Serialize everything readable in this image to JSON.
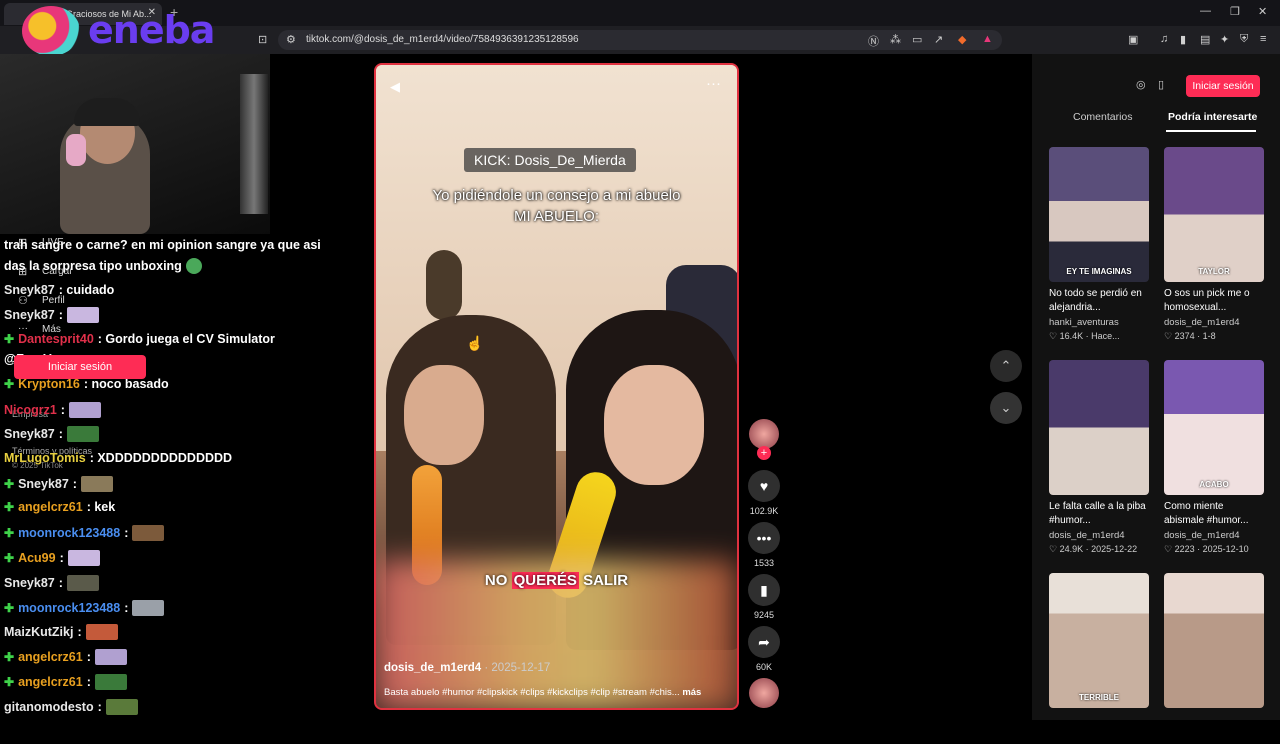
{
  "browser": {
    "tab_title": "Graciosos de Mi Ab...",
    "url": "tiktok.com/@dosis_de_m1erd4/video/7584936391235128596"
  },
  "overlay": {
    "brand": "eneba"
  },
  "tiktok_menu": {
    "live": "LIVE",
    "upload": "Cargar",
    "profile": "Perfil",
    "more": "Más",
    "login": "Iniciar sesión",
    "company": "Empresa",
    "terms": "Términos y políticas",
    "copyright": "© 2025 TikTok"
  },
  "chat": {
    "lines": [
      {
        "user": "",
        "text": "trah sangre o carne? en mi opinion sangre ya que asi",
        "color": "#ffffff"
      },
      {
        "user": "",
        "text": "das la sorpresa tipo unboxing",
        "color": "#ffffff"
      },
      {
        "user": "Sneyk87",
        "text": ": cuidado",
        "color": "#e8e8e8"
      },
      {
        "user": "Sneyk87",
        "text": ":",
        "color": "#e8e8e8"
      },
      {
        "user": "Dantesprit40",
        "text": ": Gordo juega el CV Simulator",
        "color": "#e0304a"
      },
      {
        "user": "@FgraV",
        "text": "",
        "color": "#ffffff"
      },
      {
        "user": "Krypton16",
        "text": ": noco basado",
        "color": "#e8a020"
      },
      {
        "user": "Nicogrz1",
        "text": ":",
        "color": "#e0304a"
      },
      {
        "user": "Sneyk87",
        "text": ":",
        "color": "#e8e8e8"
      },
      {
        "user": "MrLugoTomis",
        "text": ": XDDDDDDDDDDDDDD",
        "color": "#e8d040"
      },
      {
        "user": "Sneyk87",
        "text": ":",
        "color": "#e8e8e8"
      },
      {
        "user": "angelcrz61",
        "text": ": kek",
        "color": "#e8a020"
      },
      {
        "user": "moonrock123488",
        "text": ":",
        "color": "#4a8ef0"
      },
      {
        "user": "Acu99",
        "text": ":",
        "color": "#e8a020"
      },
      {
        "user": "Sneyk87",
        "text": ":",
        "color": "#e8e8e8"
      },
      {
        "user": "moonrock123488",
        "text": ":",
        "color": "#4a8ef0"
      },
      {
        "user": "MaizKutZikj",
        "text": ":",
        "color": "#e8e8e8"
      },
      {
        "user": "angelcrz61",
        "text": ":",
        "color": "#e8a020"
      },
      {
        "user": "angelcrz61",
        "text": ":",
        "color": "#e8a020"
      },
      {
        "user": "gitanomodesto",
        "text": ":",
        "color": "#e8e8e8"
      }
    ]
  },
  "video": {
    "kick_label": "KICK: Dosis_De_Mierda",
    "caption_top_1": "Yo pidiéndole un consejo a mi abuelo",
    "caption_top_2": "MI ABUELO:",
    "caption_bottom_pre": "NO ",
    "caption_bottom_hl": "QUERÉS",
    "caption_bottom_post": " SALIR",
    "author": "dosis_de_m1erd4",
    "date": "· 2025-12-17",
    "description": "Basta abuelo #humor #clipskick #clips #kickclips #clip #stream #chis...",
    "more": "más"
  },
  "actions": {
    "likes": "102.9K",
    "comments": "1533",
    "saves": "9245",
    "shares": "60K"
  },
  "right_panel": {
    "login": "Iniciar sesión",
    "tab_comments": "Comentarios",
    "tab_interest": "Podría interesarte",
    "cards": [
      {
        "title": "No todo se perdió en alejandria...",
        "channel": "hanki_aventuras",
        "stats": "♡ 16.4K · Hace...",
        "overlay": "EY TE IMAGINAS"
      },
      {
        "title": "O sos un pick me o homosexual...",
        "channel": "dosis_de_m1erd4",
        "stats": "♡ 2374 · 1-8",
        "overlay": "TAYLOR"
      },
      {
        "title": "Le falta calle a la piba #humor...",
        "channel": "dosis_de_m1erd4",
        "stats": "♡ 24.9K · 2025-12-22",
        "overlay": ""
      },
      {
        "title": "Como miente abismale #humor...",
        "channel": "dosis_de_m1erd4",
        "stats": "♡ 2223 · 2025-12-10",
        "overlay": "ACABO"
      },
      {
        "title": "",
        "channel": "",
        "stats": "",
        "overlay": "TERRIBLE"
      },
      {
        "title": "",
        "channel": "",
        "stats": "",
        "overlay": ""
      }
    ]
  },
  "colors": {
    "accent": "#fe2c55",
    "video_border": "#e03240",
    "mod_badge": "#3fd24a"
  }
}
